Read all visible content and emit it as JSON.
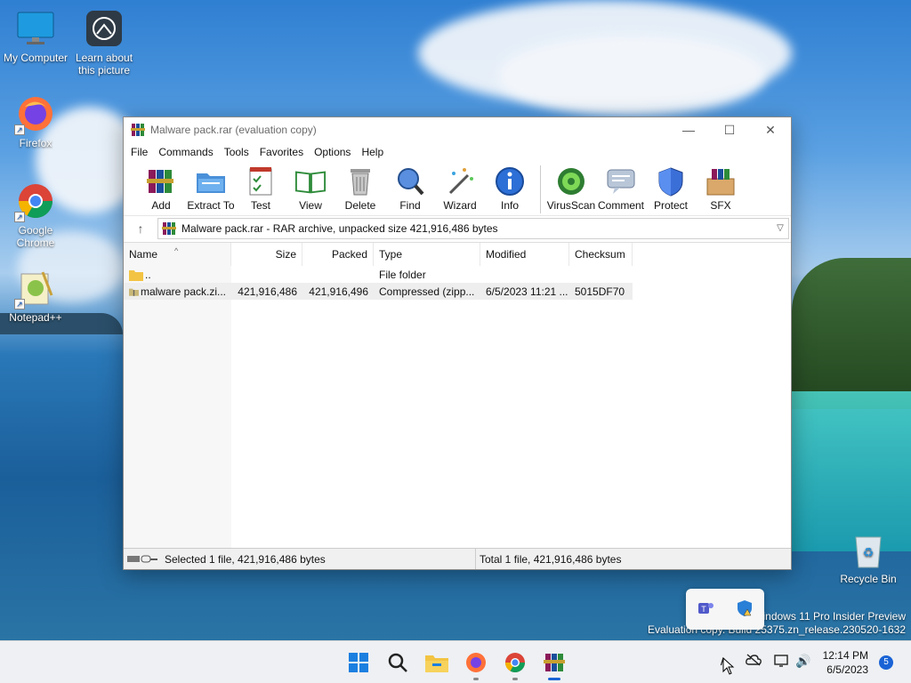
{
  "desktop": {
    "icons": [
      {
        "label": "My Computer"
      },
      {
        "label": "Learn about this picture"
      },
      {
        "label": "Firefox"
      },
      {
        "label": "Google Chrome"
      },
      {
        "label": "Notepad++"
      },
      {
        "label": "Recycle Bin"
      }
    ],
    "watermark": {
      "line1": "Windows 11 Pro Insider Preview",
      "line2": "Evaluation copy. Build 25375.zn_release.230520-1632"
    }
  },
  "window": {
    "title": "Malware pack.rar (evaluation copy)",
    "menu": [
      "File",
      "Commands",
      "Tools",
      "Favorites",
      "Options",
      "Help"
    ],
    "toolbar": [
      "Add",
      "Extract To",
      "Test",
      "View",
      "Delete",
      "Find",
      "Wizard",
      "Info",
      "VirusScan",
      "Comment",
      "Protect",
      "SFX"
    ],
    "address": "Malware pack.rar - RAR archive, unpacked size 421,916,486 bytes",
    "columns": [
      "Name",
      "Size",
      "Packed",
      "Type",
      "Modified",
      "Checksum"
    ],
    "rows": [
      {
        "name": "..",
        "size": "",
        "packed": "",
        "type": "File folder",
        "modified": "",
        "checksum": ""
      },
      {
        "name": "malware pack.zi...",
        "size": "421,916,486",
        "packed": "421,916,496",
        "type": "Compressed (zipp...",
        "modified": "6/5/2023 11:21 ...",
        "checksum": "5015DF70"
      }
    ],
    "status_left": "Selected 1 file, 421,916,486 bytes",
    "status_right": "Total 1 file, 421,916,486 bytes"
  },
  "taskbar": {
    "time": "12:14 PM",
    "date": "6/5/2023",
    "notifications": "5"
  },
  "colors": {
    "accent": "#1a63d6",
    "selection": "#eeeeee"
  }
}
